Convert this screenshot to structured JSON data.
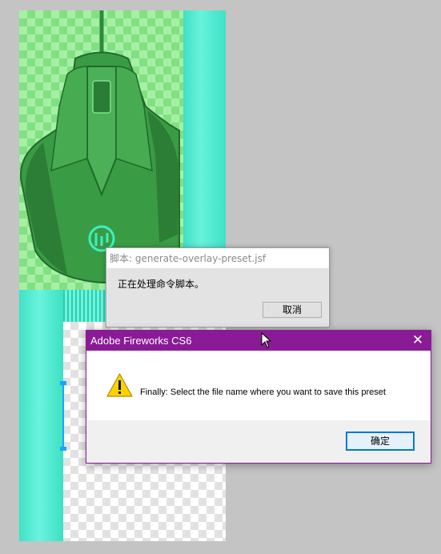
{
  "script_dialog": {
    "title": "脚本: generate-overlay-preset.jsf",
    "message": "正在处理命令脚本。",
    "cancel_label": "取消"
  },
  "alert_dialog": {
    "title": "Adobe Fireworks CS6",
    "close_glyph": "✕",
    "message": "Finally: Select the file name where you want to save this preset",
    "ok_label": "确定",
    "icon": "warning-icon"
  },
  "colors": {
    "alert_titlebar": "#8a1b96",
    "canvas_background": "#c4c4c4",
    "accent_teal": "#3fe0c4",
    "mouse_green": "#2f8f3f"
  }
}
